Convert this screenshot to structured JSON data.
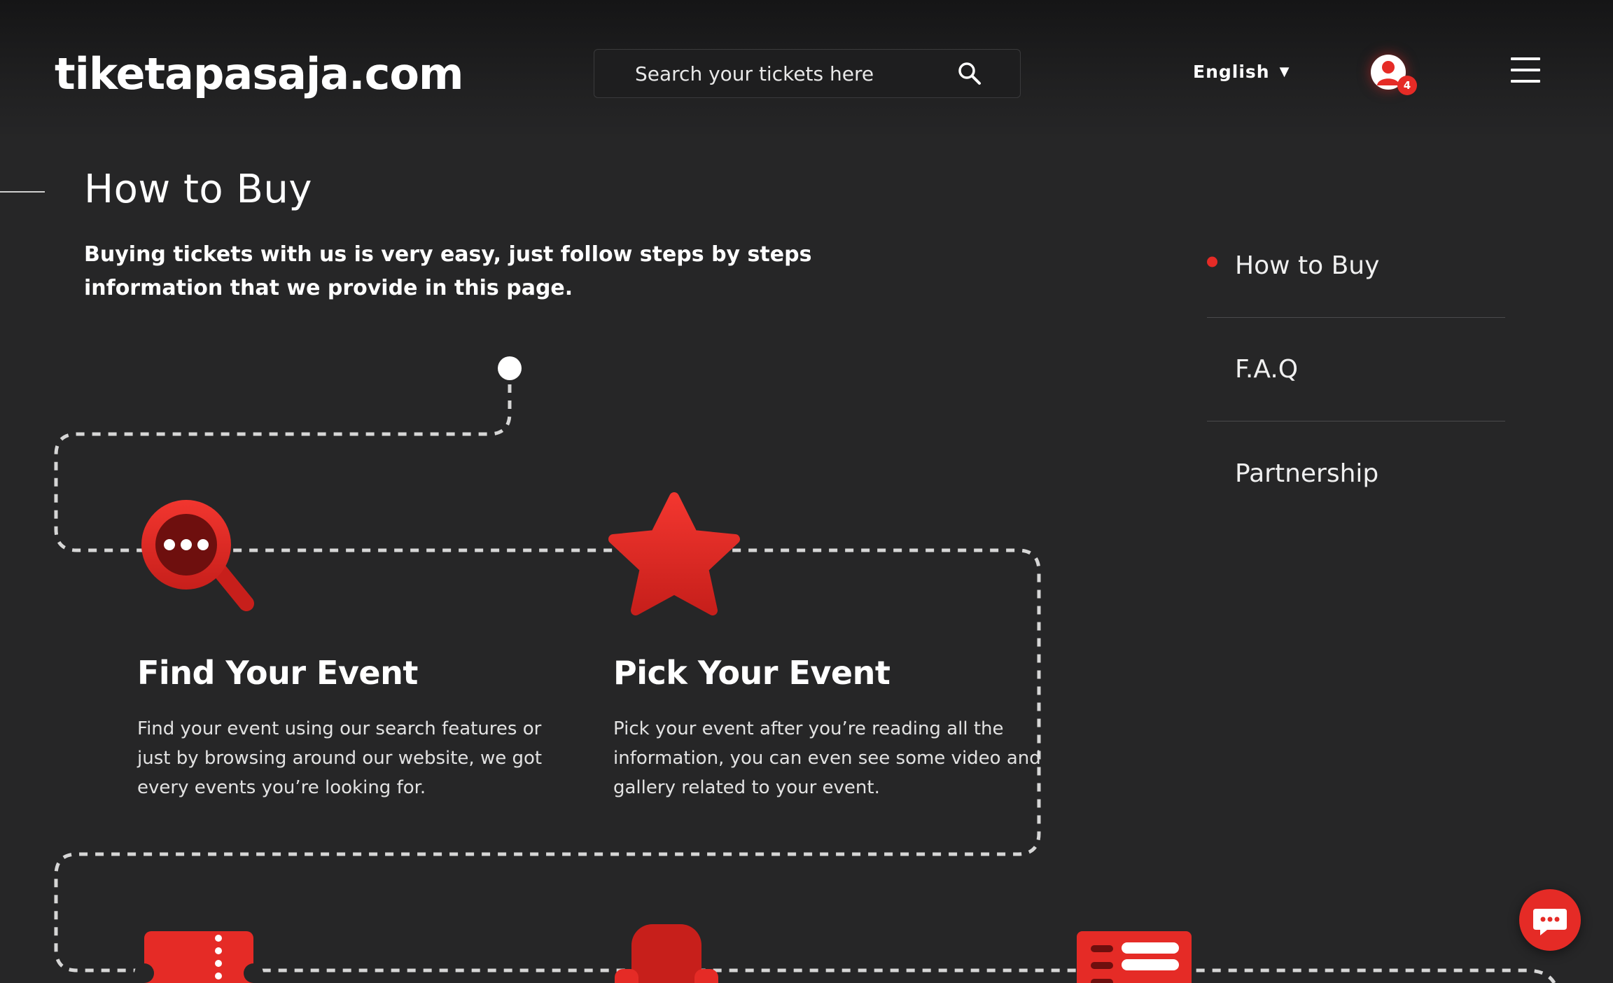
{
  "header": {
    "logo_text": "tiketapasaja.com",
    "search_placeholder": "Search your tickets here",
    "language": "English",
    "notification_count": "4"
  },
  "section": {
    "title": "How to Buy",
    "intro": "Buying tickets with us is very easy, just follow steps by steps information that we provide in this page."
  },
  "sidenav": {
    "items": [
      {
        "label": "How to Buy",
        "active": true
      },
      {
        "label": "F.A.Q",
        "active": false
      },
      {
        "label": "Partnership",
        "active": false
      }
    ]
  },
  "steps": [
    {
      "icon": "search-magnifier-icon",
      "title": "Find Your Event",
      "description": "Find your event using our search features or just by browsing around our website, we got every events you’re looking for."
    },
    {
      "icon": "star-icon",
      "title": "Pick Your Event",
      "description": "Pick your event after you’re reading all the information, you can even see some video and gallery related to your event."
    },
    {
      "icon": "ticket-icon"
    },
    {
      "icon": "seat-icon"
    },
    {
      "icon": "list-icon"
    }
  ],
  "colors": {
    "accent": "#e52b26",
    "background": "#262627",
    "header_background": "#151516"
  },
  "chat": {
    "icon": "chat-icon"
  }
}
